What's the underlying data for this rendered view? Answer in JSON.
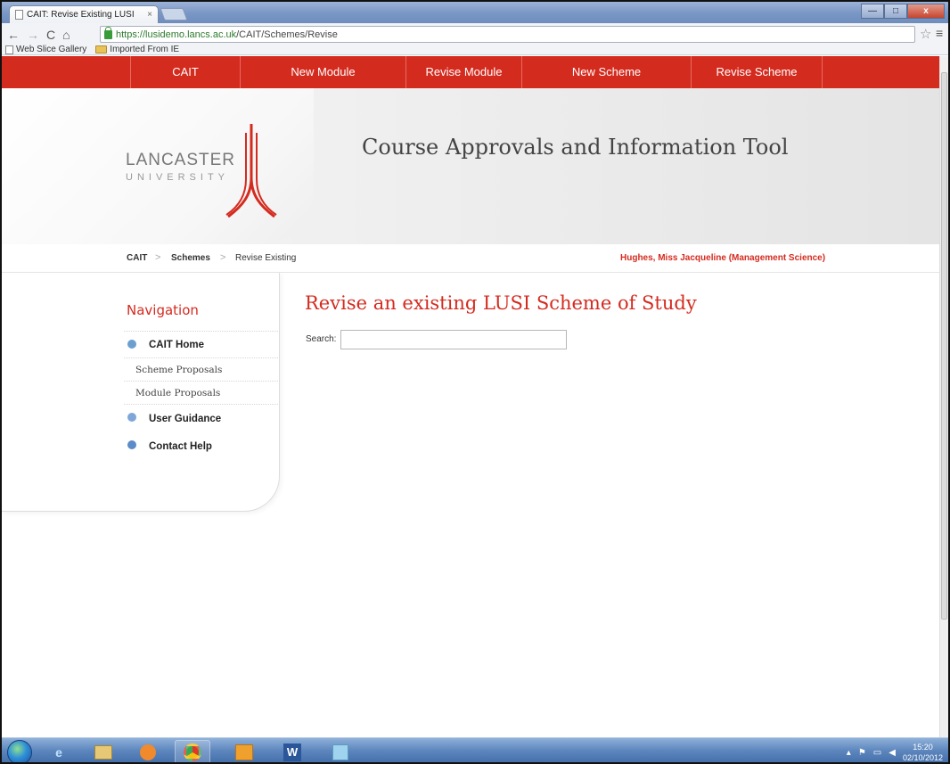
{
  "browser": {
    "tab_title": "CAIT: Revise Existing LUSI",
    "tab_close": "×",
    "url_secure": "https://lusidemo.lancs.ac.uk",
    "url_path": "/CAIT/Schemes/Revise",
    "bookmarks": [
      "Web Slice Gallery",
      "Imported From IE"
    ],
    "controls": {
      "minimize": "—",
      "maximize": "□",
      "close": "x"
    }
  },
  "topnav": {
    "items": [
      "CAIT",
      "New Module",
      "Revise Module",
      "New Scheme",
      "Revise Scheme"
    ]
  },
  "banner": {
    "logo_line1": "LANCASTER",
    "logo_line2": "UNIVERSITY",
    "title": "Course Approvals and Information Tool"
  },
  "breadcrumb": {
    "items": [
      "CAIT",
      "Schemes",
      "Revise Existing"
    ],
    "separator": ">",
    "user": "Hughes, Miss Jacqueline (Management Science)"
  },
  "sidebar": {
    "heading": "Navigation",
    "items": [
      {
        "label": "CAIT Home",
        "icon": "home-icon"
      },
      {
        "label": "Scheme Proposals"
      },
      {
        "label": "Module Proposals"
      },
      {
        "label": "User Guidance",
        "icon": "help-icon"
      },
      {
        "label": "Contact Help",
        "icon": "contact-icon"
      }
    ]
  },
  "main": {
    "title": "Revise an existing LUSI Scheme of Study",
    "search_label": "Search:",
    "search_value": ""
  },
  "taskbar": {
    "time": "15:20",
    "date": "02/10/2012"
  },
  "colors": {
    "brand_red": "#d42b1f"
  }
}
